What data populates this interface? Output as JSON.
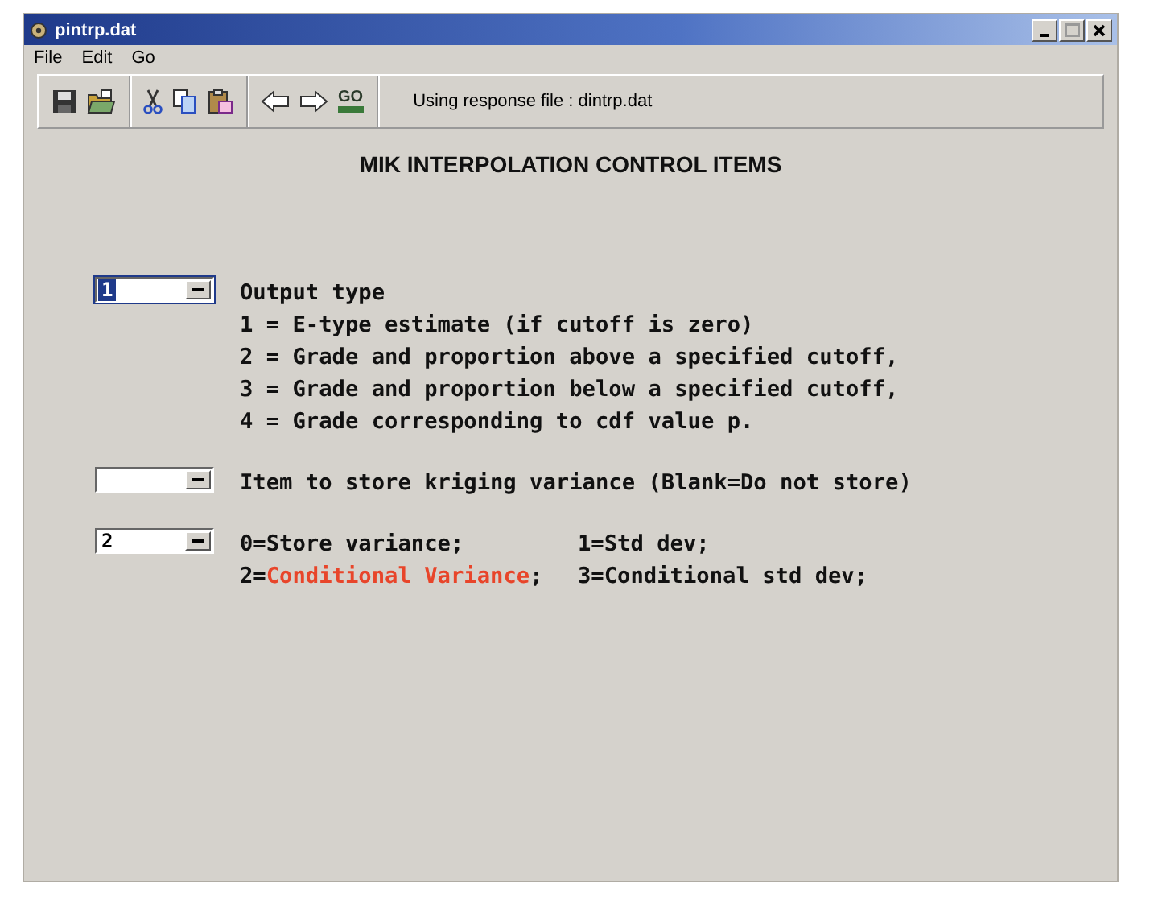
{
  "window": {
    "title": "pintrp.dat"
  },
  "menu": [
    "File",
    "Edit",
    "Go"
  ],
  "toolbar": {
    "go_label": "GO",
    "status": "Using response file : dintrp.dat"
  },
  "heading": "MIK INTERPOLATION CONTROL ITEMS",
  "fields": [
    {
      "value": "1",
      "focused": true,
      "label": "Output type",
      "options": [
        {
          "cells": [
            {
              "parts": [
                {
                  "text": "1 = E-type estimate (if cutoff is zero)",
                  "highlighted": false
                }
              ]
            }
          ]
        },
        {
          "cells": [
            {
              "parts": [
                {
                  "text": "2 = Grade and proportion above a specified cutoff,",
                  "highlighted": false
                }
              ]
            }
          ]
        },
        {
          "cells": [
            {
              "parts": [
                {
                  "text": "3 = Grade and proportion below a specified cutoff,",
                  "highlighted": false
                }
              ]
            }
          ]
        },
        {
          "cells": [
            {
              "parts": [
                {
                  "text": "4 = Grade corresponding to cdf value p.",
                  "highlighted": false
                }
              ]
            }
          ]
        }
      ]
    },
    {
      "focused": false,
      "label": "Item to store kriging variance (Blank=Do not store)"
    },
    {
      "value": "2",
      "focused": false,
      "options": [
        {
          "cells": [
            {
              "parts": [
                {
                  "text": "0=Store variance;",
                  "highlighted": false
                }
              ]
            },
            {
              "parts": [
                {
                  "text": "1=Std dev;",
                  "highlighted": false
                }
              ]
            }
          ]
        },
        {
          "cells": [
            {
              "parts": [
                {
                  "text": "2=",
                  "highlighted": false
                },
                {
                  "text": "Conditional Variance",
                  "highlighted": true
                },
                {
                  "text": ";",
                  "highlighted": false
                }
              ]
            },
            {
              "parts": [
                {
                  "text": "3=Conditional std dev;",
                  "highlighted": false
                }
              ]
            }
          ]
        }
      ]
    }
  ]
}
